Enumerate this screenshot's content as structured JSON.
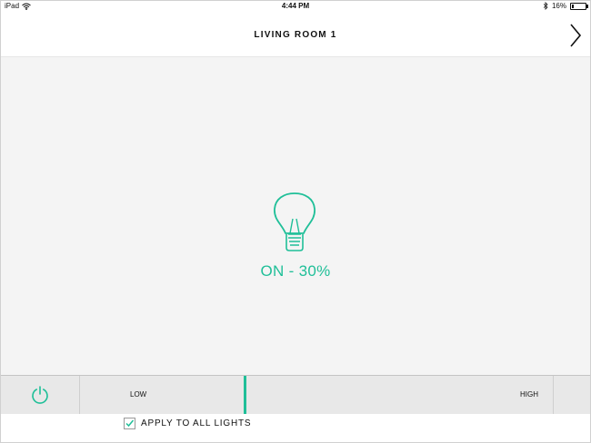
{
  "status_bar": {
    "device": "iPad",
    "time": "4:44 PM",
    "battery_text": "16%",
    "battery_level": 0.16
  },
  "nav": {
    "title": "LIVING ROOM 1",
    "next_icon": "chevron-right-icon"
  },
  "light": {
    "icon": "lightbulb-icon",
    "state_text": "ON  - 30%",
    "brightness": 0.3
  },
  "controls": {
    "power_icon": "power-icon",
    "low_label": "LOW",
    "high_label": "HIGH"
  },
  "footer": {
    "apply_all_label": "APPLY TO ALL LIGHTS",
    "apply_all_checked": true
  },
  "colors": {
    "accent": "#1fbf98",
    "background": "#f4f4f4",
    "bar": "#e8e8e8"
  }
}
